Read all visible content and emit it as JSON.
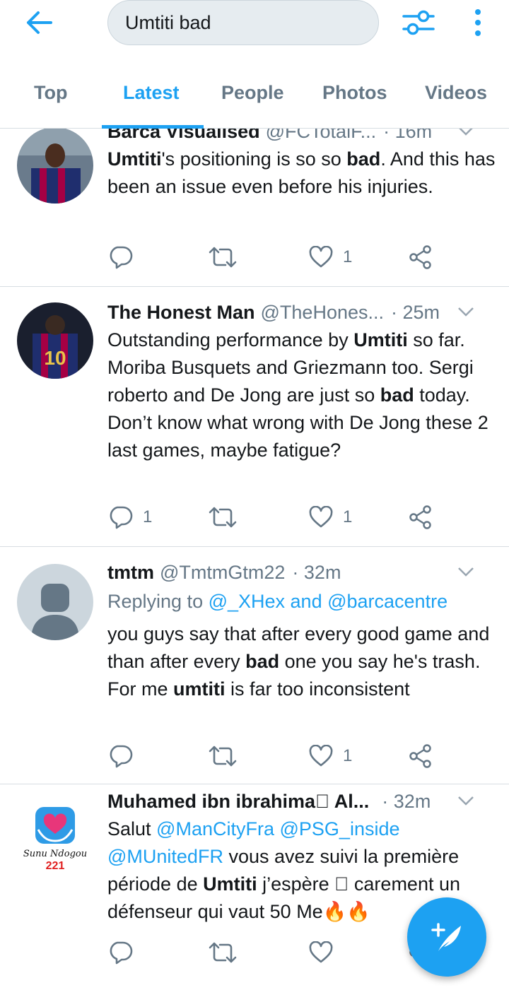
{
  "search": {
    "query": "Umtiti bad"
  },
  "tabs": [
    "Top",
    "Latest",
    "People",
    "Photos",
    "Videos"
  ],
  "active_tab": "Latest",
  "colors": {
    "accent": "#1da1f2",
    "muted": "#657786",
    "text": "#14171a",
    "divider": "#d7dde2"
  },
  "tweets": [
    {
      "name": "Barca Visualised",
      "handle": "@FCTotalF...",
      "time": "· 16m",
      "text_parts": [
        {
          "t": "Umtiti",
          "b": true
        },
        {
          "t": "'s positioning is so so "
        },
        {
          "t": "bad",
          "b": true
        },
        {
          "t": ". And this has been an issue even before his injuries."
        }
      ],
      "replies": "",
      "likes": "1"
    },
    {
      "name": "The Honest Man",
      "handle": "@TheHones...",
      "time": "· 25m",
      "text_parts": [
        {
          "t": "Outstanding performance by "
        },
        {
          "t": "Umtiti",
          "b": true
        },
        {
          "t": " so far. Moriba Busquets and Griezmann too. Sergi roberto and De Jong are just so "
        },
        {
          "t": "bad",
          "b": true
        },
        {
          "t": " today. Don’t know what wrong with De Jong these 2 last games, maybe fatigue?"
        }
      ],
      "replies": "1",
      "likes": "1"
    },
    {
      "name": "tmtm",
      "handle": "@TmtmGtm22",
      "time": "· 32m",
      "replying_prefix": "Replying to ",
      "replying_to": "@_XHex and @barcacentre",
      "text_parts": [
        {
          "t": "you guys say that after every good game and than after every "
        },
        {
          "t": "bad",
          "b": true
        },
        {
          "t": " one you say he's trash. For me "
        },
        {
          "t": "umtiti",
          "b": true
        },
        {
          "t": " is far too inconsistent"
        }
      ],
      "replies": "",
      "likes": "1"
    },
    {
      "name": "Muhamed ibn ibrahima🏽 Al...",
      "handle": "",
      "time": "· 32m",
      "avatar_caption": "Sunu Ndogou",
      "avatar_number": "221",
      "text_parts": [
        {
          "t": "Salut "
        },
        {
          "t": "@ManCityFra",
          "l": true
        },
        {
          "t": " "
        },
        {
          "t": "@PSG_inside",
          "l": true
        },
        {
          "t": " "
        },
        {
          "t": "@MUnitedFR",
          "l": true
        },
        {
          "t": " vous avez suivi la première période de "
        },
        {
          "t": "Umtiti",
          "b": true
        },
        {
          "t": " j’espère 🏽 carement un défenseur qui vaut 50 Me🔥🔥"
        }
      ],
      "replies": "",
      "likes": ""
    }
  ],
  "icons": [
    "back-arrow-icon",
    "filter-sliders-icon",
    "more-vertical-icon",
    "reply-icon",
    "retweet-icon",
    "like-icon",
    "share-icon",
    "chevron-down-icon",
    "compose-tweet-icon"
  ]
}
